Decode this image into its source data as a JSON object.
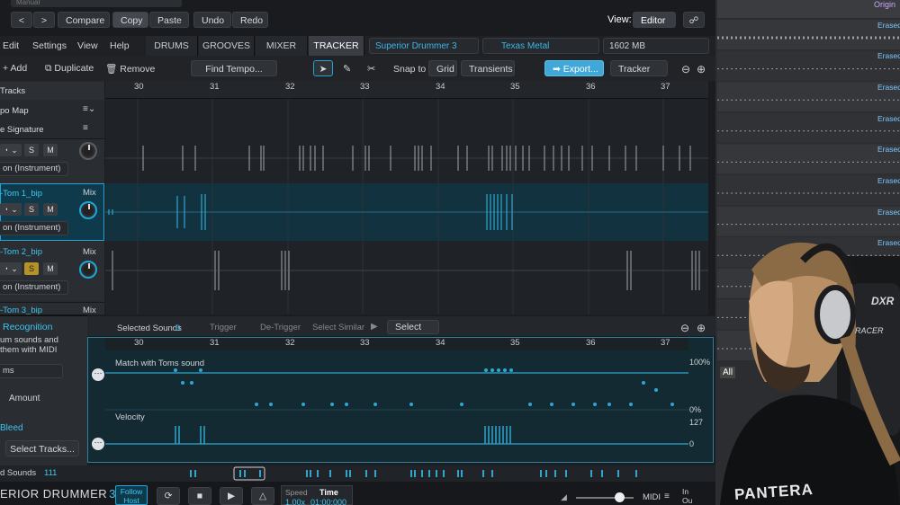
{
  "top": {
    "preset_field": "Manual",
    "nav_back": "<",
    "nav_forward": ">",
    "compare": "Compare",
    "copy": "Copy",
    "paste": "Paste",
    "undo": "Undo",
    "redo": "Redo",
    "view_label": "View:",
    "view_value": "Editor"
  },
  "menu": {
    "edit": "Edit",
    "settings": "Settings",
    "view": "View",
    "help": "Help"
  },
  "tabs": [
    "DRUMS",
    "GROOVES",
    "MIXER",
    "TRACKER"
  ],
  "product_select": "Superior Drummer 3",
  "library_select": "Texas Metal",
  "memory": "1602 MB",
  "toolbar": {
    "add": "Add",
    "duplicate": "Duplicate",
    "remove": "Remove",
    "find_tempo": "Find Tempo...",
    "snap_to": "Snap to",
    "grid": "Grid",
    "transients": "Transients",
    "export": "Export...",
    "tracker": "Tracker"
  },
  "ruler": [
    "30",
    "31",
    "32",
    "33",
    "34",
    "35",
    "36",
    "37"
  ],
  "tracks": {
    "header": "Tracks",
    "tempo_map": "po Map",
    "signature": "e Signature",
    "instrument_sel": "on (Instrument)",
    "solo": "S",
    "mute": "M",
    "mix": "Mix",
    "track1_name": "-Tom 1_bip",
    "track2_name": "-Tom 2_bip",
    "track3_name": "-Tom 3_bip"
  },
  "lower": {
    "recognition_title": "Recognition",
    "recognition_desc1": "um sounds and",
    "recognition_desc2": "them with MIDI",
    "recognition_select": "ms",
    "amount": "Amount",
    "bleed": "Bleed",
    "select_tracks": "Select Tracks...",
    "sounds_label": "d Sounds",
    "sounds_count": "111",
    "selected_sounds_label": "Selected Sounds",
    "selected_sounds_value": "0",
    "trigger": "Trigger",
    "de_trigger": "De-Trigger",
    "select_similar": "Select Similar",
    "select": "Select",
    "match_label": "Match with Toms sound",
    "pct_100": "100%",
    "pct_0": "0%",
    "velocity_label": "Velocity",
    "vel_127": "127",
    "vel_0": "0"
  },
  "transport": {
    "brand": "ERIOR DRUMMER",
    "brand_num": "3",
    "follow": "Follow",
    "host": "Host",
    "speed_label": "Speed",
    "speed_value": "1.00x",
    "time_label": "Time",
    "time_value": "01:00:000",
    "midi": "MIDI",
    "in": "In",
    "ou": "Ou"
  },
  "right_panel": {
    "original": "Origin",
    "erased": "Erased",
    "all": "All",
    "chair_brand": "DXR",
    "chair_sub": "RACER",
    "shirt": "PANTERA"
  },
  "colors": {
    "accent": "#1ea6d6",
    "tab_active": "#3a3e44",
    "track_selected": "#0f3a4c",
    "export_bg": "#3fa8d8"
  }
}
